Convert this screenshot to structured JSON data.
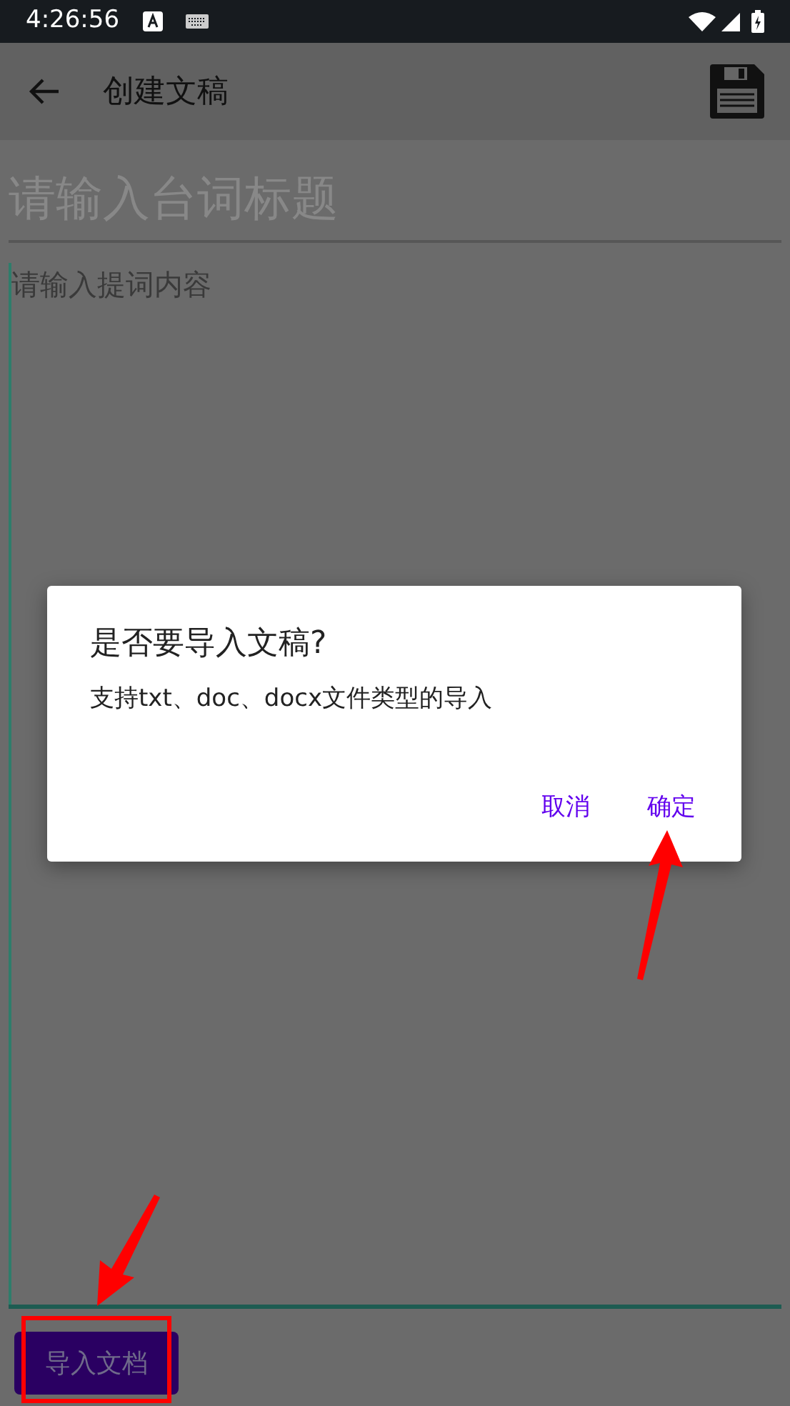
{
  "status_bar": {
    "time": "4:26:56"
  },
  "app_bar": {
    "title": "创建文稿"
  },
  "title_field": {
    "placeholder": "请输入台词标题"
  },
  "content_field": {
    "placeholder": "请输入提词内容"
  },
  "import_button": {
    "label": "导入文档"
  },
  "dialog": {
    "title": "是否要导入文稿?",
    "message": "支持txt、doc、docx文件类型的导入",
    "buttons": [
      {
        "label": "取消"
      },
      {
        "label": "确定"
      }
    ]
  }
}
